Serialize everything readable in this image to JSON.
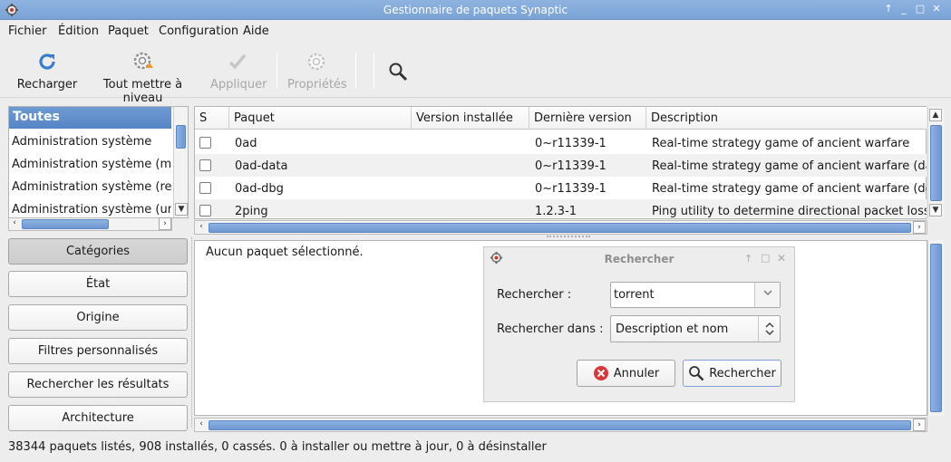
{
  "window": {
    "title": "Gestionnaire de paquets Synaptic"
  },
  "menu": [
    "Fichier",
    "Édition",
    "Paquet",
    "Configuration",
    "Aide"
  ],
  "toolbar": {
    "reload": "Recharger",
    "upgrade_all": "Tout mettre à niveau",
    "apply": "Appliquer",
    "properties": "Propriétés"
  },
  "categories": {
    "header": "Toutes",
    "items": [
      "Administration système",
      "Administration système (multiv",
      "Administration système (restri",
      "Administration système (unive"
    ]
  },
  "filter_buttons": [
    "Catégories",
    "État",
    "Origine",
    "Filtres personnalisés",
    "Rechercher les résultats",
    "Architecture"
  ],
  "table": {
    "columns": [
      "S",
      "Paquet",
      "Version installée",
      "Dernière version",
      "Description"
    ],
    "rows": [
      {
        "package": "0ad",
        "installed": "",
        "latest": "0~r11339-1",
        "description": "Real-time strategy game of ancient warfare"
      },
      {
        "package": "0ad-data",
        "installed": "",
        "latest": "0~r11339-1",
        "description": "Real-time strategy game of ancient warfare (data)"
      },
      {
        "package": "0ad-dbg",
        "installed": "",
        "latest": "0~r11339-1",
        "description": "Real-time strategy game of ancient warfare (debug"
      },
      {
        "package": "2ping",
        "installed": "",
        "latest": "1.2.3-1",
        "description": "Ping utility to determine directional packet loss"
      }
    ]
  },
  "details": {
    "text": "Aucun paquet sélectionné."
  },
  "search_dialog": {
    "title": "Rechercher",
    "search_label": "Rechercher :",
    "search_value": "torrent",
    "search_in_label": "Rechercher dans :",
    "search_in_value": "Description et nom",
    "cancel": "Annuler",
    "search": "Rechercher"
  },
  "status": "38344 paquets listés, 908 installés, 0 cassés. 0 à installer ou mettre à jour, 0 à désinstaller"
}
